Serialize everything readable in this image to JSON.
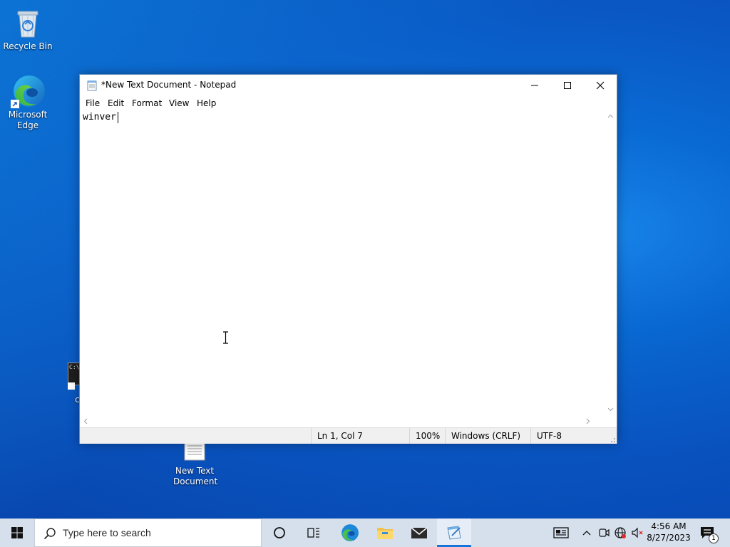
{
  "desktop": {
    "icons": [
      {
        "label": "Recycle Bin"
      },
      {
        "label": "Microsoft Edge"
      },
      {
        "label": "New Text Document"
      }
    ],
    "partial_icon_label": "c"
  },
  "notepad": {
    "title": "*New Text Document - Notepad",
    "menu": [
      "File",
      "Edit",
      "Format",
      "View",
      "Help"
    ],
    "content": "winver",
    "status": {
      "position": "Ln 1, Col 7",
      "zoom": "100%",
      "line_ending": "Windows (CRLF)",
      "encoding": "UTF-8"
    }
  },
  "taskbar": {
    "search_placeholder": "Type here to search",
    "pinned": [
      "cortana-icon",
      "task-view-icon",
      "edge-icon",
      "file-explorer-icon",
      "mail-icon",
      "notepad-icon"
    ],
    "active_app": "notepad",
    "tray_icons": [
      "news-icon",
      "chevron-up-icon",
      "meet-now-icon",
      "network-icon",
      "volume-muted-icon"
    ],
    "time": "4:56 AM",
    "date": "8/27/2023",
    "notification_count": "1"
  },
  "colors": {
    "accent": "#1a73d9",
    "taskbar": "#d6e0ed",
    "desktop": "#0a6fd8"
  }
}
